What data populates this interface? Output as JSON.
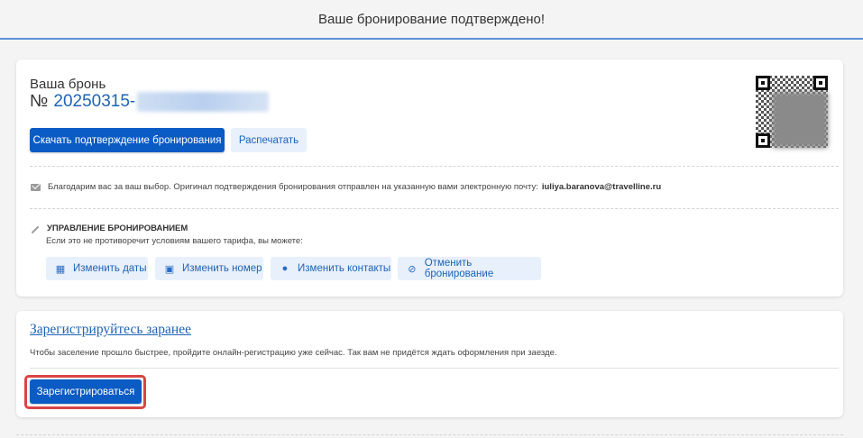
{
  "header": {
    "title": "Ваше бронирование подтверждено!"
  },
  "booking": {
    "label": "Ваша бронь",
    "number_prefix": "№",
    "number_visible": "20250315-"
  },
  "buttons": {
    "download": "Скачать подтверждение бронирования",
    "print": "Распечатать"
  },
  "message": {
    "text": "Благодарим вас за ваш выбор. Оригинал подтверждения бронирования отправлен на указанную вами электронную почту:",
    "email": "iuliya.baranova@travelline.ru"
  },
  "manage": {
    "title": "УПРАВЛЕНИЕ БРОНИРОВАНИЕМ",
    "subtitle": "Если это не противоречит условиям вашего тарифа, вы можете:",
    "actions": [
      {
        "label": "Изменить даты",
        "icon": "calendar-icon"
      },
      {
        "label": "Изменить номер",
        "icon": "bed-icon"
      },
      {
        "label": "Изменить контакты",
        "icon": "user-edit-icon"
      },
      {
        "label": "Отменить бронирование",
        "icon": "cancel-icon"
      }
    ]
  },
  "registration": {
    "title": "Зарегистрируйтесь заранее",
    "text": "Чтобы заселение прошло быстрее, пройдите онлайн-регистрацию уже сейчас. Так вам не придётся ждать оформления при заезде.",
    "button": "Зарегистрироваться",
    "highlight_color": "#d94545"
  },
  "colors": {
    "primary": "#0a5bc4",
    "link": "#1e63b6",
    "secondary_bg": "#e8f0fb",
    "header_border": "#5b8fd6"
  }
}
